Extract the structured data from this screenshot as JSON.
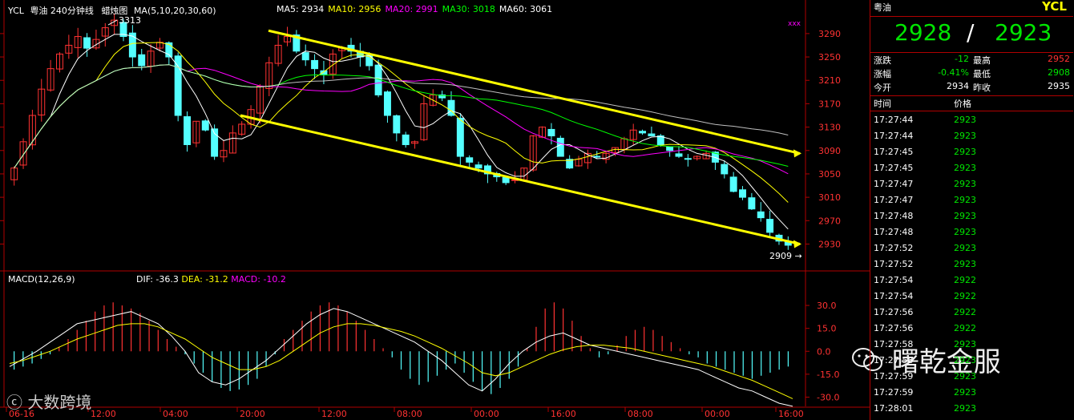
{
  "header": {
    "symbol": "YCL",
    "title": "粤油 240分钟线",
    "chart_style": "蜡烛图",
    "ma_params": "MA(5,10,20,30,60)",
    "ma": [
      {
        "label": "MA5:",
        "value": "2934",
        "color": "#ffffff"
      },
      {
        "label": "MA10:",
        "value": "2956",
        "color": "#ffff00"
      },
      {
        "label": "MA20:",
        "value": "2991",
        "color": "#ff00ff"
      },
      {
        "label": "MA30:",
        "value": "3018",
        "color": "#00ff00"
      },
      {
        "label": "MA60:",
        "value": "3061",
        "color": "#ffffff"
      }
    ]
  },
  "macd_header": {
    "name": "MACD(12,26,9)",
    "dif": "DIF: -36.3",
    "dea": "DEA: -31.2",
    "macd": "MACD: -10.2"
  },
  "markers": {
    "high_label": "3313",
    "low_label": "2909",
    "xxx": "xxx"
  },
  "chart_data": [
    {
      "type": "candlestick",
      "title": "粤油 240分钟线",
      "y_ticks": [
        3290,
        3250,
        3210,
        3170,
        3130,
        3090,
        3050,
        3010,
        2970,
        2930
      ],
      "ylim": [
        2895,
        3320
      ],
      "x_ticks": [
        "06-16",
        "12:00",
        "04:00",
        "20:00",
        "12:00",
        "08:00",
        "00:00",
        "16:00",
        "08:00",
        "00:00",
        "16:00"
      ],
      "close_approx": [
        3060,
        3105,
        3150,
        3195,
        3230,
        3255,
        3270,
        3285,
        3265,
        3280,
        3300,
        3313,
        3285,
        3250,
        3235,
        3260,
        3275,
        3250,
        3150,
        3100,
        3140,
        3125,
        3080,
        3090,
        3120,
        3135,
        3160,
        3200,
        3240,
        3270,
        3285,
        3260,
        3245,
        3230,
        3220,
        3255,
        3265,
        3260,
        3250,
        3235,
        3185,
        3150,
        3120,
        3100,
        3105,
        3170,
        3185,
        3180,
        3150,
        3080,
        3070,
        3060,
        3050,
        3045,
        3035,
        3040,
        3060,
        3115,
        3130,
        3115,
        3080,
        3060,
        3075,
        3085,
        3080,
        3085,
        3095,
        3110,
        3125,
        3120,
        3115,
        3100,
        3090,
        3080,
        3075,
        3080,
        3085,
        3070,
        3050,
        3020,
        3010,
        2990,
        2975,
        2950,
        2935,
        2928
      ],
      "ma_series": [
        "MA5",
        "MA10",
        "MA20",
        "MA30",
        "MA60"
      ],
      "channel_upper": [
        [
          3295,
          "start"
        ],
        [
          3085,
          "end"
        ]
      ],
      "channel_lower": [
        [
          3150,
          "start"
        ],
        [
          2930,
          "end"
        ]
      ],
      "high": 3313,
      "low": 2909
    },
    {
      "type": "bar",
      "title": "MACD(12,26,9)",
      "y_ticks": [
        30.0,
        15.0,
        0.0,
        -15.0,
        -30.0
      ],
      "ylim": [
        -35,
        40
      ],
      "macd_hist": [
        -12,
        -10,
        -8,
        -5,
        -2,
        3,
        8,
        14,
        20,
        26,
        30,
        32,
        30,
        28,
        25,
        20,
        14,
        8,
        3,
        -2,
        -8,
        -14,
        -20,
        -24,
        -26,
        -25,
        -22,
        -18,
        -10,
        -2,
        8,
        14,
        20,
        26,
        30,
        32,
        30,
        26,
        20,
        14,
        8,
        2,
        -4,
        -12,
        -18,
        -22,
        -20,
        -16,
        -12,
        -8,
        -14,
        -20,
        -26,
        -28,
        -24,
        -18,
        -10,
        2,
        16,
        28,
        32,
        28,
        20,
        10,
        2,
        -4,
        -2,
        4,
        10,
        14,
        16,
        14,
        10,
        6,
        2,
        -2,
        -4,
        -8,
        -10,
        -12,
        -14,
        -16,
        -18,
        -16,
        -14,
        -12,
        -10
      ],
      "dif": [
        -10,
        -5,
        0,
        6,
        12,
        18,
        20,
        22,
        24,
        26,
        22,
        18,
        10,
        0,
        -14,
        -20,
        -22,
        -18,
        -12,
        -6,
        2,
        10,
        18,
        24,
        28,
        26,
        22,
        18,
        14,
        10,
        6,
        0,
        -6,
        -14,
        -22,
        -26,
        -18,
        -8,
        0,
        6,
        10,
        12,
        8,
        4,
        2,
        0,
        -2,
        -4,
        -6,
        -8,
        -10,
        -12,
        -16,
        -20,
        -24,
        -26,
        -30,
        -34,
        -36
      ],
      "dea": [
        -8,
        -6,
        -3,
        0,
        4,
        8,
        11,
        14,
        17,
        18,
        18,
        16,
        12,
        8,
        2,
        -4,
        -8,
        -12,
        -12,
        -10,
        -6,
        0,
        6,
        12,
        16,
        18,
        18,
        17,
        15,
        13,
        10,
        6,
        2,
        -3,
        -8,
        -14,
        -16,
        -14,
        -10,
        -6,
        -2,
        1,
        3,
        4,
        4,
        3,
        2,
        0,
        -2,
        -4,
        -6,
        -8,
        -10,
        -13,
        -16,
        -19,
        -23,
        -27,
        -31
      ]
    }
  ],
  "panel": {
    "name": "粤油",
    "symbol": "YCL",
    "bid": "2928",
    "slash": "/",
    "ask": "2923",
    "stats": [
      {
        "l1": "涨跌",
        "v1": "-12",
        "l2": "最高",
        "v2": "2952"
      },
      {
        "l1": "涨幅",
        "v1": "-0.41%",
        "l2": "最低",
        "v2": "2908"
      },
      {
        "l1": "今开",
        "v1": "2934",
        "l2": "昨收",
        "v2": "2935"
      }
    ],
    "col_time": "时间",
    "col_price": "价格",
    "ticks": [
      {
        "t": "17:27:44",
        "p": "2923"
      },
      {
        "t": "17:27:44",
        "p": "2923"
      },
      {
        "t": "17:27:45",
        "p": "2923"
      },
      {
        "t": "17:27:45",
        "p": "2923"
      },
      {
        "t": "17:27:47",
        "p": "2923"
      },
      {
        "t": "17:27:47",
        "p": "2923"
      },
      {
        "t": "17:27:48",
        "p": "2923"
      },
      {
        "t": "17:27:48",
        "p": "2923"
      },
      {
        "t": "17:27:52",
        "p": "2923"
      },
      {
        "t": "17:27:52",
        "p": "2923"
      },
      {
        "t": "17:27:54",
        "p": "2922"
      },
      {
        "t": "17:27:54",
        "p": "2922"
      },
      {
        "t": "17:27:56",
        "p": "2922"
      },
      {
        "t": "17:27:56",
        "p": "2922"
      },
      {
        "t": "17:27:58",
        "p": "2923"
      },
      {
        "t": "17:27:58",
        "p": "2923"
      },
      {
        "t": "17:27:59",
        "p": "2923"
      },
      {
        "t": "17:27:59",
        "p": "2923"
      },
      {
        "t": "17:28:01",
        "p": "2923"
      }
    ]
  },
  "watermarks": {
    "left": "大数跨境",
    "right": "曙乾金服"
  },
  "colors": {
    "up": "#ff3232",
    "down": "#54ffff",
    "panel_green": "#00e600",
    "panel_red": "#ff3232",
    "channel": "#ffff00",
    "axis": "#b00000"
  }
}
